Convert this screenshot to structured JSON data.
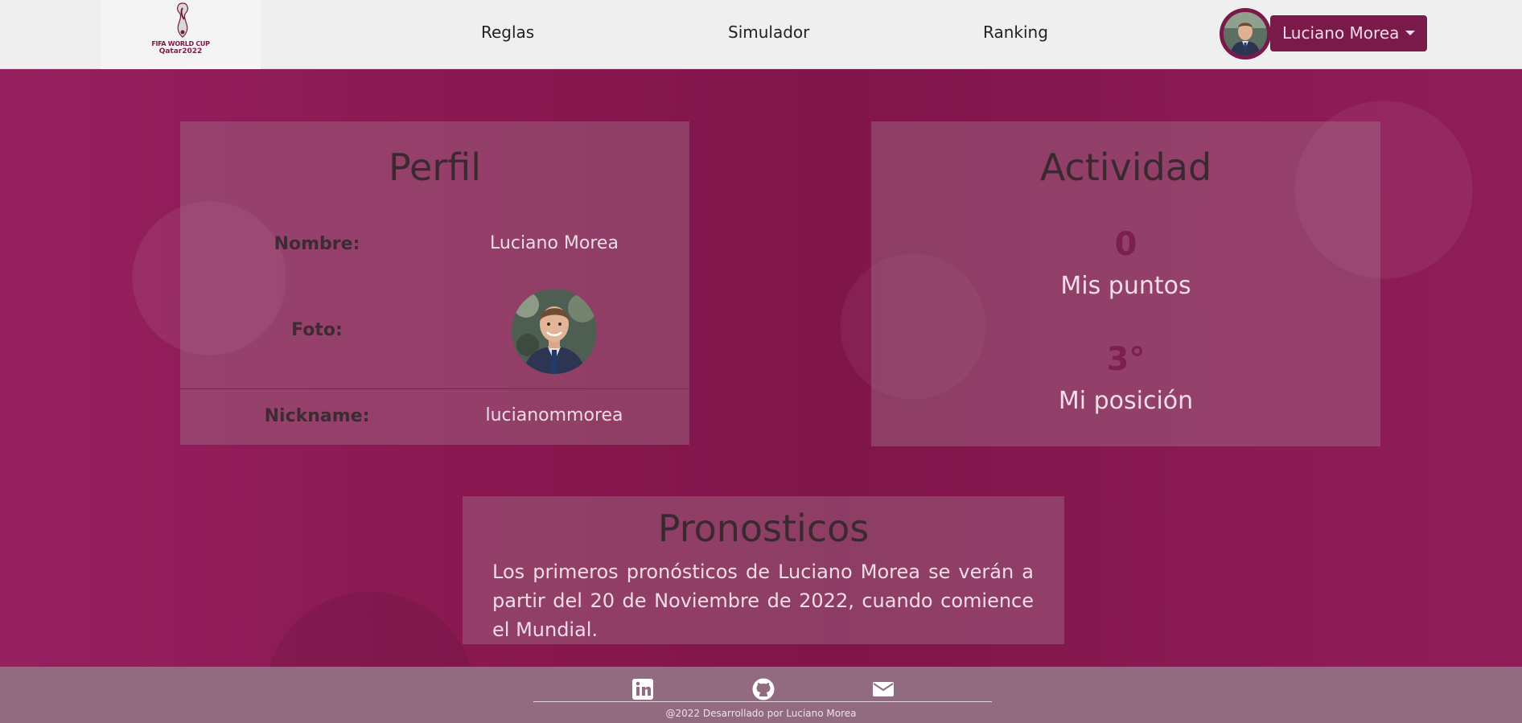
{
  "navbar": {
    "logo_line1": "FIFA WORLD CUP",
    "logo_line2": "Qatar2022",
    "links": [
      "Reglas",
      "Simulador",
      "Ranking"
    ],
    "user_name": "Luciano Morea"
  },
  "profile": {
    "title": "Perfil",
    "name_label": "Nombre:",
    "name_value": "Luciano Morea",
    "photo_label": "Foto:",
    "nickname_label": "Nickname:",
    "nickname_value": "lucianommorea"
  },
  "activity": {
    "title": "Actividad",
    "points_value": "0",
    "points_label": "Mis puntos",
    "position_value": "3°",
    "position_label": "Mi posición"
  },
  "predictions": {
    "title": "Pronosticos",
    "text": "Los primeros pronósticos de Luciano Morea se verán a partir del 20 de Noviembre de 2022, cuando comience el Mundial."
  },
  "footer": {
    "icons": [
      "linkedin-icon",
      "github-icon",
      "mail-icon"
    ],
    "copyright": "@2022 Desarrollado por Luciano Morea"
  },
  "colors": {
    "brand": "#7a1a4a",
    "background": "#8b1a55",
    "footer": "#926b80"
  }
}
